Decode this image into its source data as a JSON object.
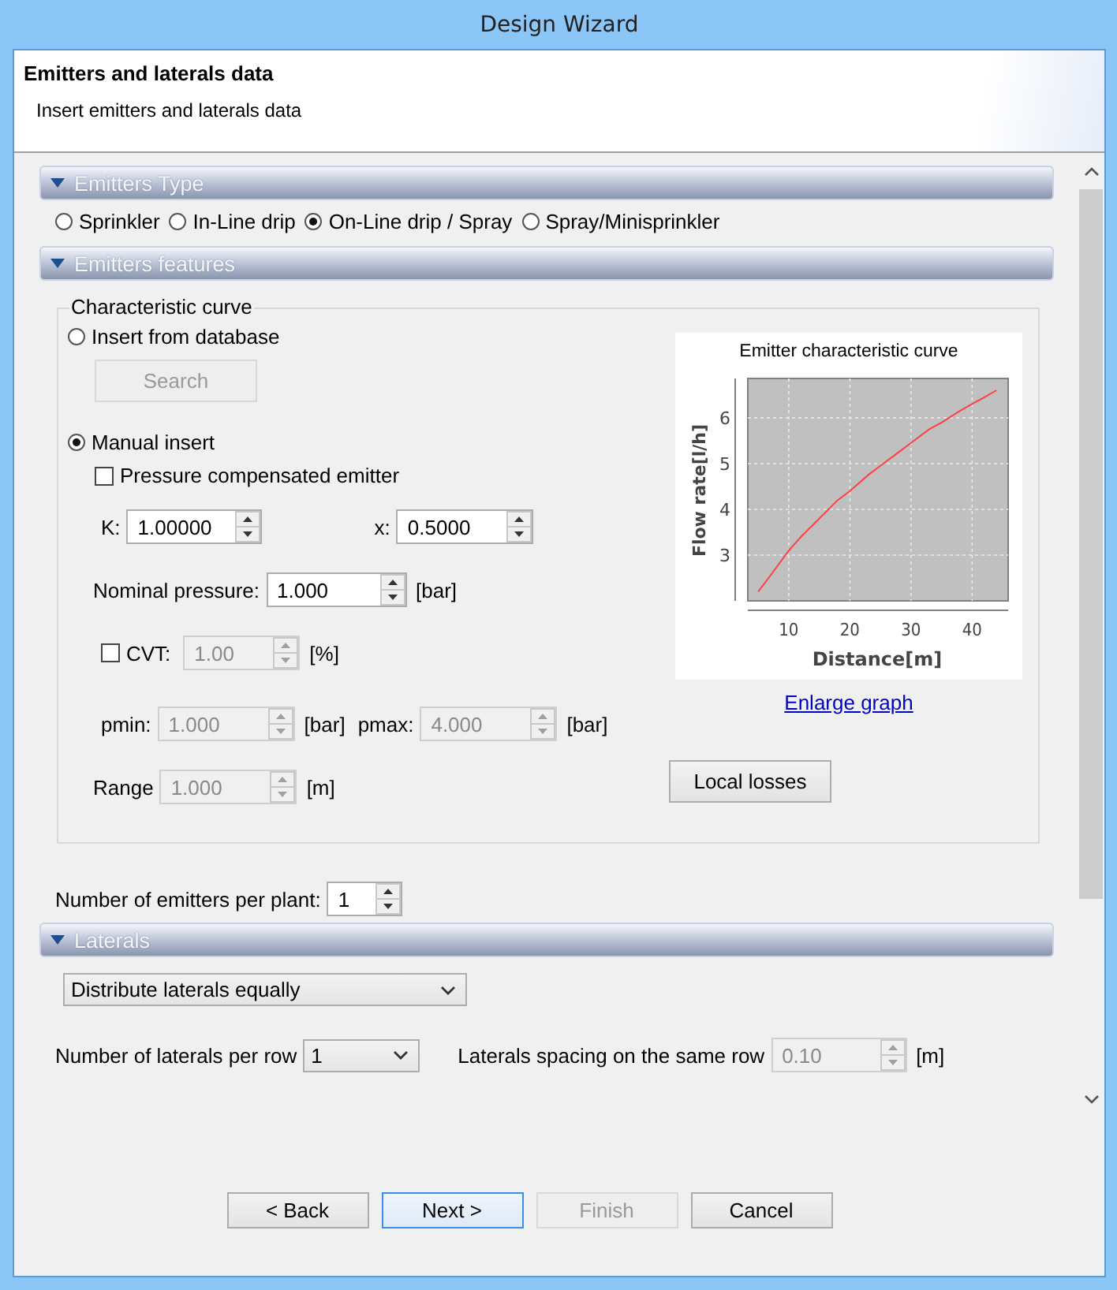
{
  "window": {
    "title": "Design Wizard"
  },
  "header": {
    "title": "Emitters and laterals data",
    "subtitle": "Insert emitters and laterals data"
  },
  "emitters_type": {
    "title": "Emitters Type",
    "expanded": true,
    "options": [
      {
        "label": "Sprinkler",
        "selected": false
      },
      {
        "label": "In-Line drip",
        "selected": false
      },
      {
        "label": "On-Line drip / Spray",
        "selected": true
      },
      {
        "label": "Spray/Minisprinkler",
        "selected": false
      }
    ]
  },
  "emitters_features": {
    "title": "Emitters features",
    "expanded": true,
    "group_title": "Characteristic curve",
    "modes": [
      {
        "label": "Insert from database",
        "selected": false
      },
      {
        "label": "Manual insert",
        "selected": true
      }
    ],
    "search_button": {
      "label": "Search",
      "disabled": true
    },
    "pressure_compensated": {
      "label": "Pressure compensated emitter",
      "checked": false
    },
    "k": {
      "label": "K:",
      "value": "1.00000",
      "disabled": false
    },
    "x": {
      "label": "x:",
      "value": "0.5000",
      "disabled": false
    },
    "nominal_pressure": {
      "label": "Nominal pressure:",
      "value": "1.000",
      "unit": "[bar]",
      "disabled": false
    },
    "cvt": {
      "label": "CVT:",
      "checked": false,
      "value": "1.00",
      "unit": "[%]",
      "disabled": true
    },
    "pmin": {
      "label": "pmin:",
      "value": "1.000",
      "unit": "[bar]",
      "disabled": true
    },
    "pmax": {
      "label": "pmax:",
      "value": "4.000",
      "unit": "[bar]",
      "disabled": true
    },
    "range": {
      "label": "Range",
      "value": "1.000",
      "unit": "[m]",
      "disabled": true
    },
    "chart_data": {
      "type": "line",
      "title": "Emitter characteristic curve",
      "xlabel": "Distance[m]",
      "ylabel": "Flow rate[l/h]",
      "x": [
        5,
        7,
        10,
        12,
        15,
        18,
        20,
        23,
        25,
        28,
        30,
        33,
        35,
        38,
        40,
        42,
        44
      ],
      "series": [
        {
          "color": "#ff4040",
          "values": [
            2.2,
            2.55,
            3.1,
            3.4,
            3.8,
            4.2,
            4.4,
            4.75,
            4.95,
            5.25,
            5.45,
            5.75,
            5.9,
            6.15,
            6.3,
            6.45,
            6.6
          ]
        }
      ],
      "xlim": [
        3.3,
        45.9
      ],
      "ylim": [
        2,
        6.86
      ],
      "grid": true,
      "xticks": [
        10,
        20,
        30,
        40
      ],
      "yticks": [
        3,
        4,
        5,
        6
      ]
    },
    "enlarge_link": "Enlarge graph",
    "local_losses_button": {
      "label": "Local losses",
      "disabled": false
    }
  },
  "emitters_per_plant": {
    "label": "Number of emitters per plant:",
    "value": "1",
    "disabled": false
  },
  "laterals": {
    "title": "Laterals",
    "expanded": true,
    "distribution": "Distribute laterals equally",
    "per_row": {
      "label": "Number of laterals per row",
      "value": "1"
    },
    "spacing": {
      "label": "Laterals spacing on the same row",
      "value": "0.10",
      "unit": "[m]",
      "disabled": true
    }
  },
  "buttons": [
    {
      "label": "< Back",
      "disabled": false,
      "focused": false
    },
    {
      "label": "Next >",
      "disabled": false,
      "focused": true
    },
    {
      "label": "Finish",
      "disabled": true,
      "focused": false
    },
    {
      "label": "Cancel",
      "disabled": false,
      "focused": false
    }
  ]
}
